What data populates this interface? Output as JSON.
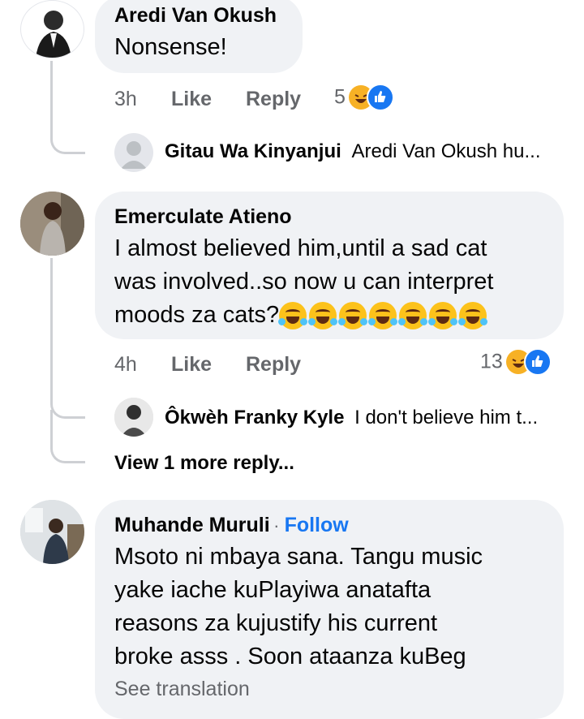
{
  "comments": [
    {
      "author": "Aredi Van Okush",
      "text": "Nonsense!",
      "time": "3h",
      "like_label": "Like",
      "reply_label": "Reply",
      "reaction_count": "5",
      "reply_preview": {
        "author": "Gitau Wa Kinyanjui",
        "text": "Aredi Van Okush hu..."
      }
    },
    {
      "author": "Emerculate Atieno",
      "text_lines": [
        "I almost believed him,until a sad cat",
        "was involved..so now u can interpret",
        "moods za cats?"
      ],
      "time": "4h",
      "like_label": "Like",
      "reply_label": "Reply",
      "reaction_count": "13",
      "reply_preview": {
        "author": "Ôkwèh Franky Kyle",
        "text": "I don't believe him t..."
      },
      "view_more": "View 1 more reply..."
    },
    {
      "author": "Muhande Muruli",
      "follow_label": "Follow",
      "text_lines": [
        "Msoto ni mbaya sana. Tangu music",
        "yake iache kuPlayiwa anatafta",
        "reasons za kujustify his current",
        "broke asss . Soon ataanza kuBeg"
      ],
      "see_translation": "See translation"
    }
  ],
  "colors": {
    "bubble": "#f0f2f5",
    "meta": "#65676b",
    "link": "#1877f2",
    "haha": "#f7b125"
  },
  "icons": [
    "haha-reaction-icon",
    "like-reaction-icon",
    "rolling-laughing-emoji"
  ]
}
